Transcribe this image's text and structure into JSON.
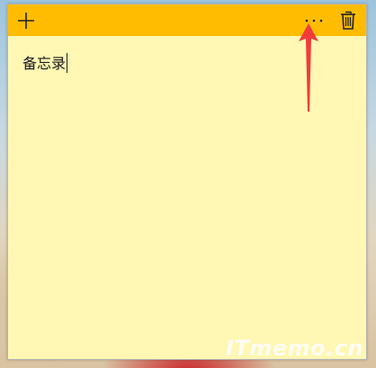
{
  "note": {
    "body_text": "备忘录",
    "toolbar": {
      "add_icon": "plus-icon",
      "more_icon": "ellipsis-icon",
      "delete_icon": "trash-icon"
    }
  },
  "annotation": {
    "arrow_color": "#f03c3c"
  },
  "watermark": {
    "text": "ITmemo.cn"
  },
  "colors": {
    "titlebar": "#ffbc00",
    "note_background": "#fff7b3"
  }
}
